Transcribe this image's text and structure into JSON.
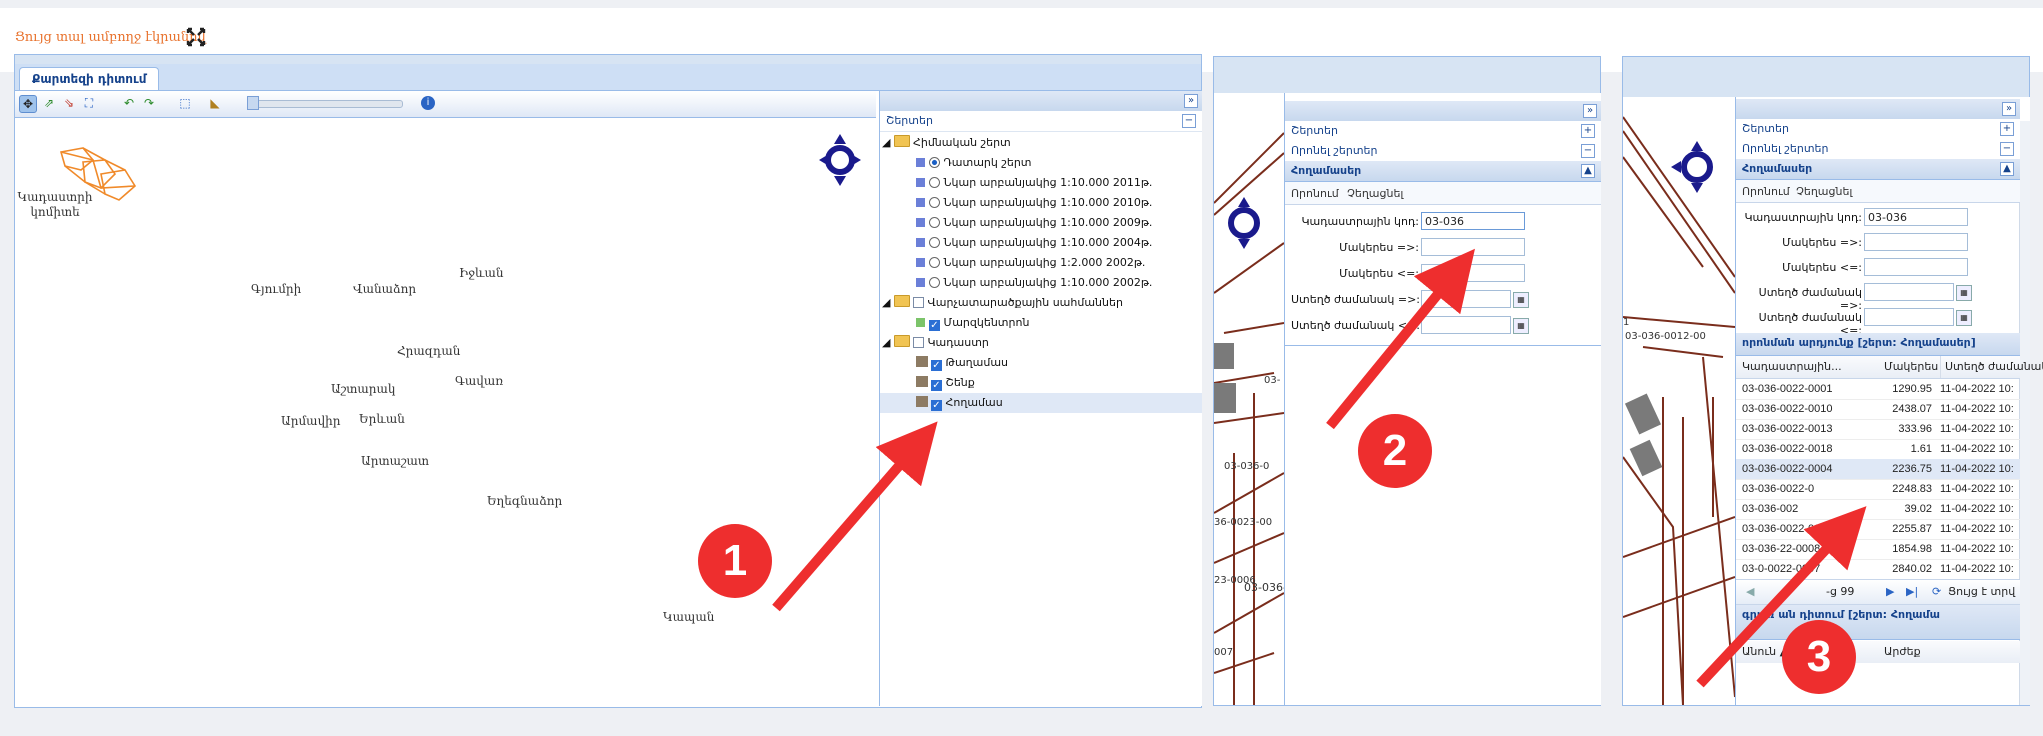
{
  "header": {
    "title": "Ցույց տալ ամբողջ էկրանով",
    "fullscreen_icon": "expand-arrows-icon"
  },
  "panel1": {
    "tab": "Քարտեզի դիտում",
    "map_legend": "Կադաստրի կոմիտե",
    "towns": [
      "Գյումրի",
      "Վանաձոր",
      "Իջևան",
      "Հրազդան",
      "Աշտարակ",
      "Գավառ",
      "Արմավիր",
      "Երևան",
      "Արտաշատ",
      "Եղեգնաձոր",
      "Կապան"
    ],
    "layers_header": "Շերտեր",
    "tree": [
      {
        "label": "Հիմնական շերտ",
        "kind": "folder"
      },
      {
        "label": "Դատարկ շերտ",
        "kind": "radio",
        "checked": true
      },
      {
        "label": "Նկար արբանյակից 1:10.000 2011թ.",
        "kind": "radio"
      },
      {
        "label": "Նկար արբանյակից 1:10.000 2010թ.",
        "kind": "radio"
      },
      {
        "label": "Նկար արբանյակից 1:10.000 2009թ.",
        "kind": "radio"
      },
      {
        "label": "Նկար արբանյակից 1:10.000 2004թ.",
        "kind": "radio"
      },
      {
        "label": "Նկար արբանյակից 1:2.000 2002թ.",
        "kind": "radio"
      },
      {
        "label": "Նկար արբանյակից 1:10.000 2002թ.",
        "kind": "radio"
      },
      {
        "label": "Վարչատարածքային սահմաններ",
        "kind": "folder-check"
      },
      {
        "label": "Մարզկենտրոն",
        "kind": "check",
        "checked": true
      },
      {
        "label": "Կադաստր",
        "kind": "folder-check"
      },
      {
        "label": "Թաղամաս",
        "kind": "check",
        "checked": true
      },
      {
        "label": "Շենք",
        "kind": "check",
        "checked": true
      },
      {
        "label": "Հողամաս",
        "kind": "check",
        "checked": true
      }
    ]
  },
  "panel2": {
    "sections": [
      "Շերտեր",
      "Որոնել շերտեր",
      "Հողամասեր"
    ],
    "subtabs": [
      "Որոնում",
      "Չեղացնել"
    ],
    "fields": [
      {
        "label": "Կադաստրային կոդ:",
        "value": "03-036"
      },
      {
        "label": "Մակերես =>:",
        "value": ""
      },
      {
        "label": "Մակերես <=:",
        "value": ""
      },
      {
        "label": "Ստեղծ ժամանակ =>:",
        "value": ""
      },
      {
        "label": "Ստեղծ ժամանակ <=:",
        "value": ""
      }
    ],
    "map_labels": [
      "03-",
      "03-036-0",
      "36-0023-00",
      "23-0006",
      "03-036-",
      "007"
    ]
  },
  "panel3": {
    "sections": [
      "Շերտեր",
      "Որոնել շերտեր",
      "Հողամասեր"
    ],
    "subtabs": [
      "Որոնում",
      "Չեղացնել"
    ],
    "fields": [
      {
        "label": "Կադաստրային կոդ:",
        "value": "03-036"
      },
      {
        "label": "Մակերես =>:",
        "value": ""
      },
      {
        "label": "Մակերես <=:",
        "value": ""
      },
      {
        "label": "Ստեղծ ժամանակ =>:",
        "value": ""
      },
      {
        "label": "Ստեղծ ժամանակ <=:",
        "value": ""
      }
    ],
    "results_title": "որոնման արդյունք [շերտ: Հողամասեր]",
    "columns": [
      "Կադաստրային...",
      "Մակերես",
      "Ստեղծ ժամանակ"
    ],
    "rows": [
      [
        "03-036-0022-0001",
        "1290.95",
        "11-04-2022 10:"
      ],
      [
        "03-036-0022-0010",
        "2438.07",
        "11-04-2022 10:"
      ],
      [
        "03-036-0022-0013",
        "333.96",
        "11-04-2022 10:"
      ],
      [
        "03-036-0022-0018",
        "1.61",
        "11-04-2022 10:"
      ],
      [
        "03-036-0022-0004",
        "2236.75",
        "11-04-2022 10:"
      ],
      [
        "03-036-0022-0",
        "2248.83",
        "11-04-2022 10:"
      ],
      [
        "03-036-002",
        "39.02",
        "11-04-2022 10:"
      ],
      [
        "03-036-0022-00",
        "2255.87",
        "11-04-2022 10:"
      ],
      [
        "03-036-22-0008",
        "1854.98",
        "11-04-2022 10:"
      ],
      [
        "03-0-0022-0007",
        "2840.02",
        "11-04-2022 10:"
      ]
    ],
    "pager": "-ց 99",
    "pager_refresh": "Ցույց է տրվ",
    "details_title": "գրառ   ան դիտում [շերտ: Հողամա",
    "details_cols": [
      "Անուն ▲",
      "Արժեք"
    ],
    "map_labels": [
      "03-036-0012-00",
      "1"
    ]
  },
  "callouts": [
    "1",
    "2",
    "3"
  ],
  "colors": {
    "accent": "#e8712b",
    "callout": "#ee2e2e",
    "arrow": "#ee2e2e",
    "header_blue": "#15428b"
  }
}
